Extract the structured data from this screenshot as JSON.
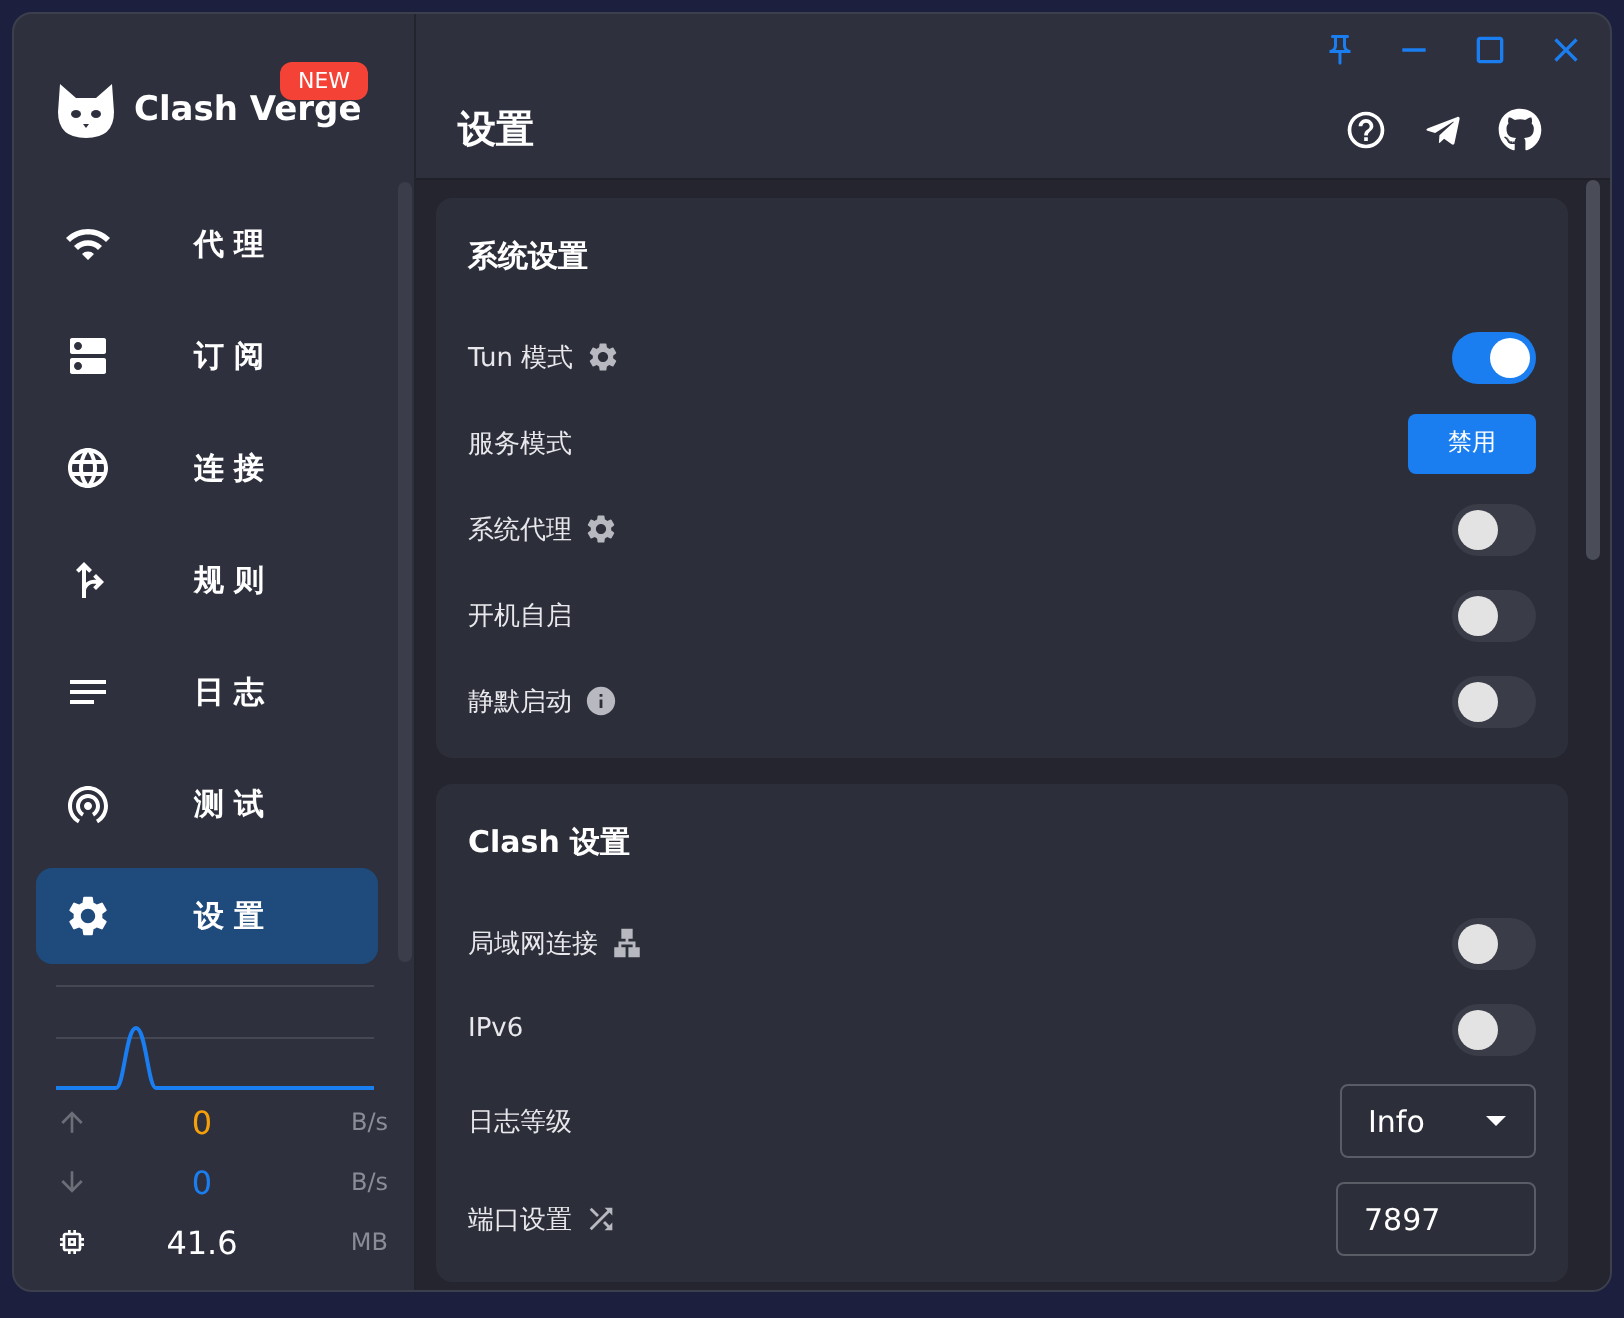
{
  "sidebar": {
    "logo": "Clash Verge",
    "badge": "NEW",
    "items": [
      {
        "label": "代 理",
        "selected": false
      },
      {
        "label": "订 阅",
        "selected": false
      },
      {
        "label": "连 接",
        "selected": false
      },
      {
        "label": "规 则",
        "selected": false
      },
      {
        "label": "日 志",
        "selected": false
      },
      {
        "label": "测 试",
        "selected": false
      },
      {
        "label": "设 置",
        "selected": true
      }
    ],
    "traffic": {
      "up": {
        "value": "0",
        "unit": "B/s"
      },
      "down": {
        "value": "0",
        "unit": "B/s"
      },
      "memory": {
        "value": "41.6",
        "unit": "MB"
      }
    }
  },
  "page": {
    "title": "设置"
  },
  "sections": [
    {
      "title": "系统设置",
      "rows": [
        {
          "label": "Tun 模式",
          "kind": "toggle",
          "on": true
        },
        {
          "label": "服务模式",
          "kind": "button",
          "button": "禁用"
        },
        {
          "label": "系统代理",
          "kind": "toggle",
          "on": false
        },
        {
          "label": "开机自启",
          "kind": "toggle",
          "on": false
        },
        {
          "label": "静默启动",
          "kind": "toggle",
          "on": false
        }
      ]
    },
    {
      "title": "Clash 设置",
      "rows": [
        {
          "label": "局域网连接",
          "kind": "toggle",
          "on": false
        },
        {
          "label": "IPv6",
          "kind": "toggle",
          "on": false
        },
        {
          "label": "日志等级",
          "kind": "select",
          "value": "Info"
        },
        {
          "label": "端口设置",
          "kind": "input",
          "value": "7897"
        }
      ]
    }
  ]
}
